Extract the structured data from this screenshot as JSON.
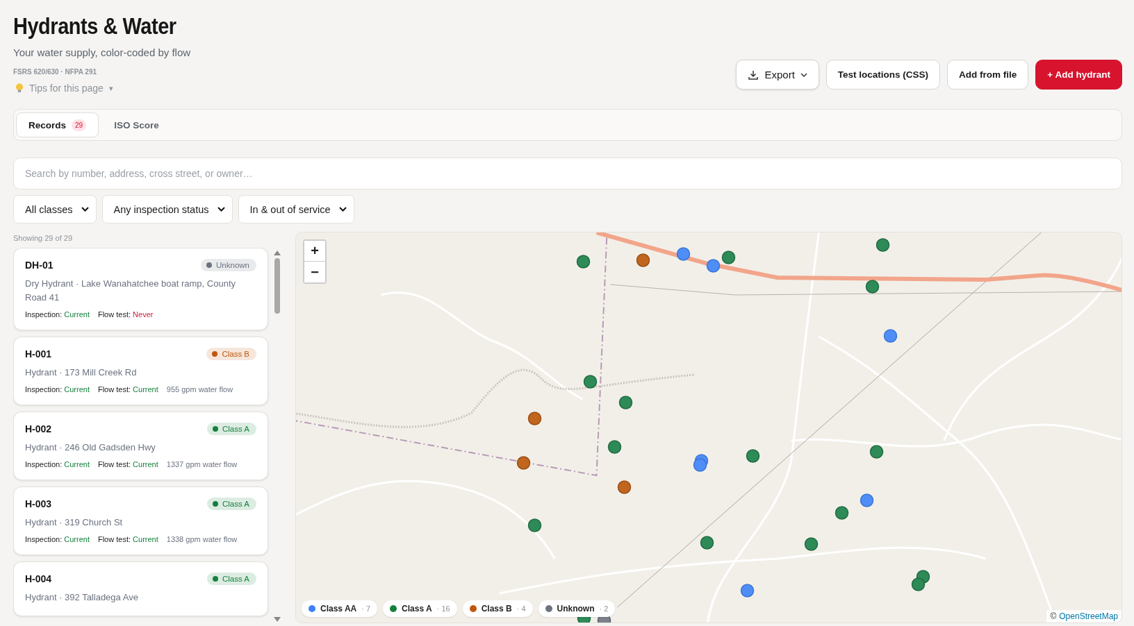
{
  "header": {
    "title": "Hydrants & Water",
    "subtitle": "Your water supply, color-coded by flow",
    "standards": "FSRS 620/630 · NFPA 291",
    "tips": {
      "label": "Tips for this page",
      "caret": "▾",
      "expanded": false
    }
  },
  "actions": [
    {
      "kind": "menu",
      "label": "Export"
    },
    {
      "kind": "plain",
      "label": "Test locations (CSS)"
    },
    {
      "kind": "plain",
      "label": "Add from file"
    },
    {
      "kind": "primary",
      "label": "+ Add hydrant"
    }
  ],
  "tabs": [
    {
      "label": "Records",
      "count": "29",
      "selected": true
    },
    {
      "label": "ISO Score",
      "selected": false
    }
  ],
  "search": {
    "placeholder": "Search by number, address, cross street, or owner…"
  },
  "filters": [
    {
      "value": "All classes"
    },
    {
      "value": "Any inspection status"
    },
    {
      "value": "In & out of service"
    }
  ],
  "showing": "Showing 29 of 29",
  "records": [
    {
      "id": "DH-01",
      "badge": {
        "label": "Unknown",
        "color": "#6b7280"
      },
      "description": "Dry Hydrant · Lake Wanahatchee boat ramp, County Road 41",
      "inspection": {
        "label": "Inspection:",
        "value": "Current",
        "ok": true
      },
      "flow_test": {
        "label": "Flow test:",
        "value": "Never",
        "ok": false
      }
    },
    {
      "id": "H-001",
      "badge": {
        "label": "Class B",
        "color": "#c2570c"
      },
      "description": "Hydrant · 173 Mill Creek Rd",
      "inspection": {
        "label": "Inspection:",
        "value": "Current",
        "ok": true
      },
      "flow_test": {
        "label": "Flow test:",
        "value": "Current",
        "ok": true
      },
      "flow": "955 gpm water flow"
    },
    {
      "id": "H-002",
      "badge": {
        "label": "Class A",
        "color": "#15803d"
      },
      "description": "Hydrant · 246 Old Gadsden Hwy",
      "inspection": {
        "label": "Inspection:",
        "value": "Current",
        "ok": true
      },
      "flow_test": {
        "label": "Flow test:",
        "value": "Current",
        "ok": true
      },
      "flow": "1337 gpm water flow"
    },
    {
      "id": "H-003",
      "badge": {
        "label": "Class A",
        "color": "#15803d"
      },
      "description": "Hydrant · 319 Church St",
      "inspection": {
        "label": "Inspection:",
        "value": "Current",
        "ok": true
      },
      "flow_test": {
        "label": "Flow test:",
        "value": "Current",
        "ok": true
      },
      "flow": "1338 gpm water flow"
    },
    {
      "id": "H-004",
      "badge": {
        "label": "Class A",
        "color": "#15803d"
      },
      "description": "Hydrant · 392 Talladega Ave"
    }
  ],
  "map": {
    "zoom_in": "+",
    "zoom_out": "−",
    "legend": [
      {
        "label": "Class AA",
        "count": "· 7",
        "color": "#3b82f6"
      },
      {
        "label": "Class A",
        "count": "· 16",
        "color": "#15803d"
      },
      {
        "label": "Class B",
        "count": "· 4",
        "color": "#c2570c"
      },
      {
        "label": "Unknown",
        "count": "· 2",
        "color": "#6b7280"
      }
    ],
    "attribution": {
      "symbol": "©",
      "link": "OpenStreetMap"
    }
  }
}
